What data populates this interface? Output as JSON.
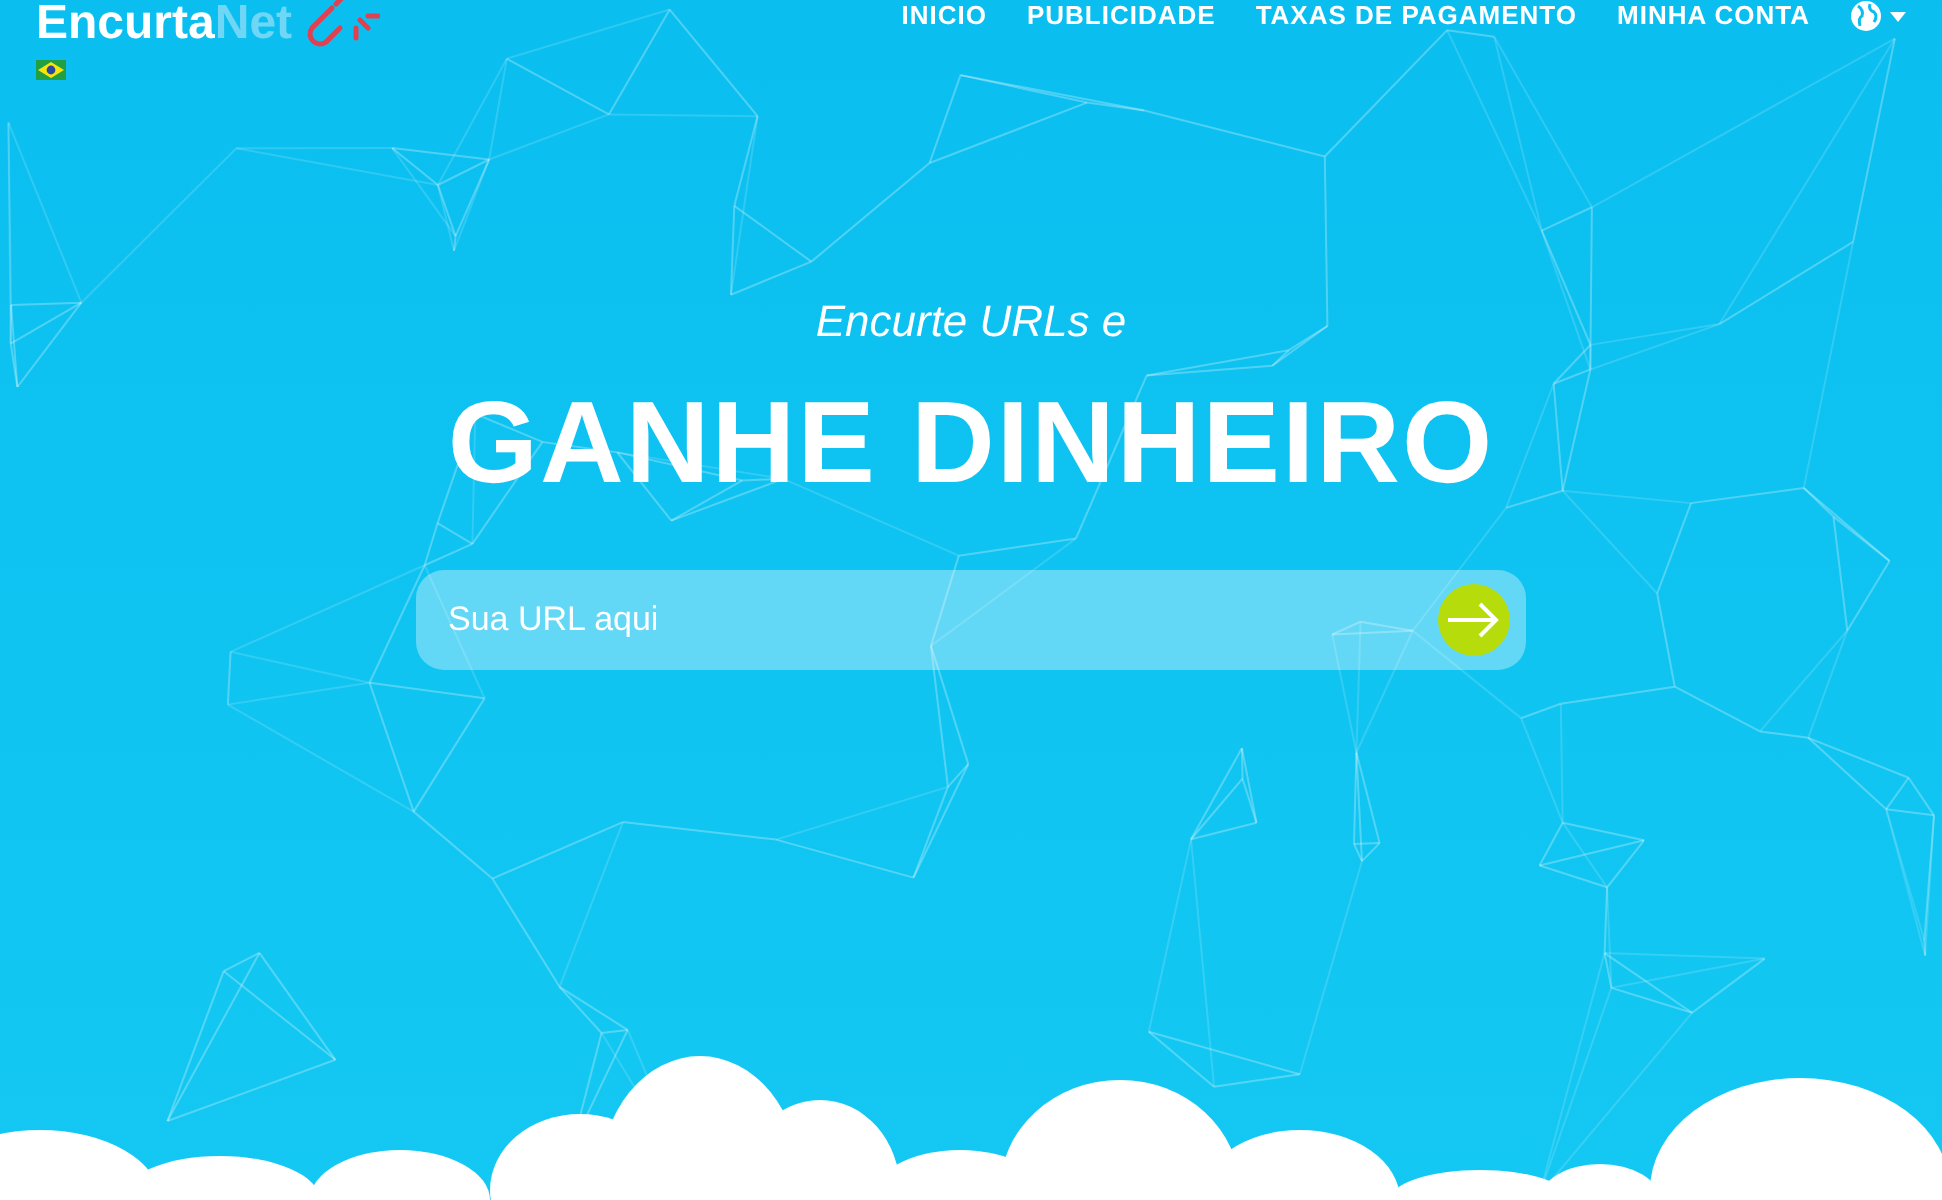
{
  "logo": {
    "primary": "Encurta",
    "secondary": "Net"
  },
  "nav": {
    "items": [
      {
        "label": "INICIO"
      },
      {
        "label": "PUBLICIDADE"
      },
      {
        "label": "TAXAS DE PAGAMENTO"
      },
      {
        "label": "MINHA CONTA"
      }
    ]
  },
  "hero": {
    "subtitle": "Encurte URLs e",
    "title": "GANHE DINHEIRO"
  },
  "url_form": {
    "placeholder": "Sua URL aqui"
  }
}
